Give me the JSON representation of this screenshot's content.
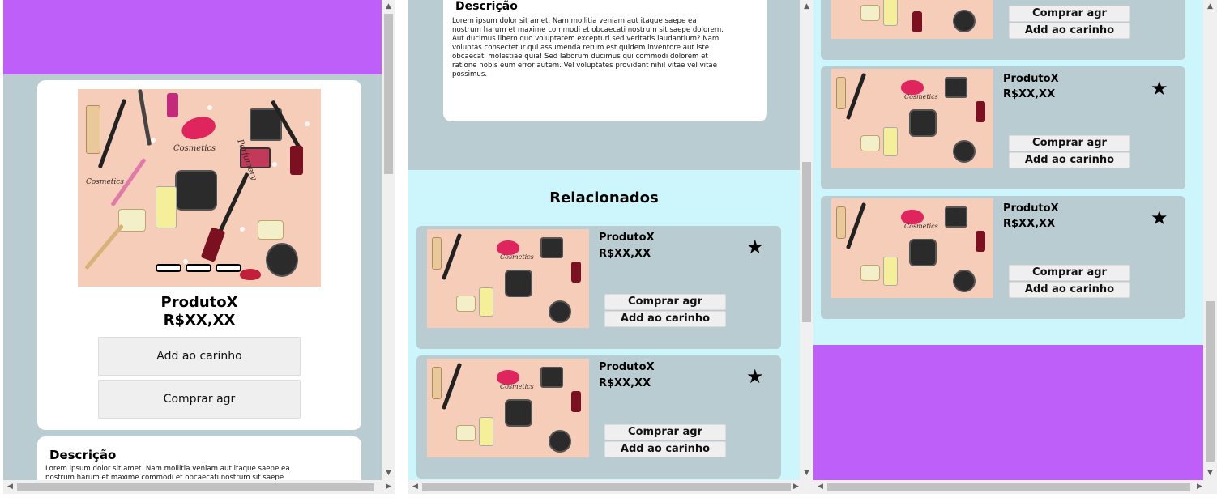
{
  "colors": {
    "banner": "#bf5ffa",
    "pageBg": "#b9ccd1",
    "relatedBg": "#ccf5fc",
    "card": "#ffffff",
    "button": "#efefef",
    "scrollbar": "#f0f0f0"
  },
  "product": {
    "name": "ProdutoX",
    "price": "R$XX,XX",
    "add_cart": "Add ao carinho",
    "buy_now": "Comprar agr"
  },
  "description": {
    "title": "Descrição",
    "text": "Lorem ipsum dolor sit amet. Nam mollitia veniam aut itaque saepe ea nostrum harum et maxime commodi et obcaecati nostrum sit saepe dolorem. Aut ducimus libero quo voluptatem excepturi sed veritatis laudantium? Nam voluptas consectetur qui assumenda rerum est quidem inventore aut iste obcaecati molestiae quia! Sed laborum ducimus qui commodi dolorem et ratione nobis eum error autem. Vel voluptates provident nihil vitae vel vitae possimus.",
    "text_partial": "Lorem ipsum dolor sit amet. Nam mollitia veniam aut itaque saepe ea nostrum harum et maxime commodi et obcaecati nostrum sit saepe"
  },
  "related": {
    "title": "Relacionados",
    "item": {
      "name": "ProdutoX",
      "price": "R$XX,XX",
      "buy_now": "Comprar agr",
      "add_cart": "Add ao carinho",
      "favorite_icon": "star-icon",
      "favorite_glyph": "★"
    }
  },
  "icons": {
    "scroll_up": "▲",
    "scroll_down": "▼",
    "scroll_left": "◀",
    "scroll_right": "▶"
  }
}
